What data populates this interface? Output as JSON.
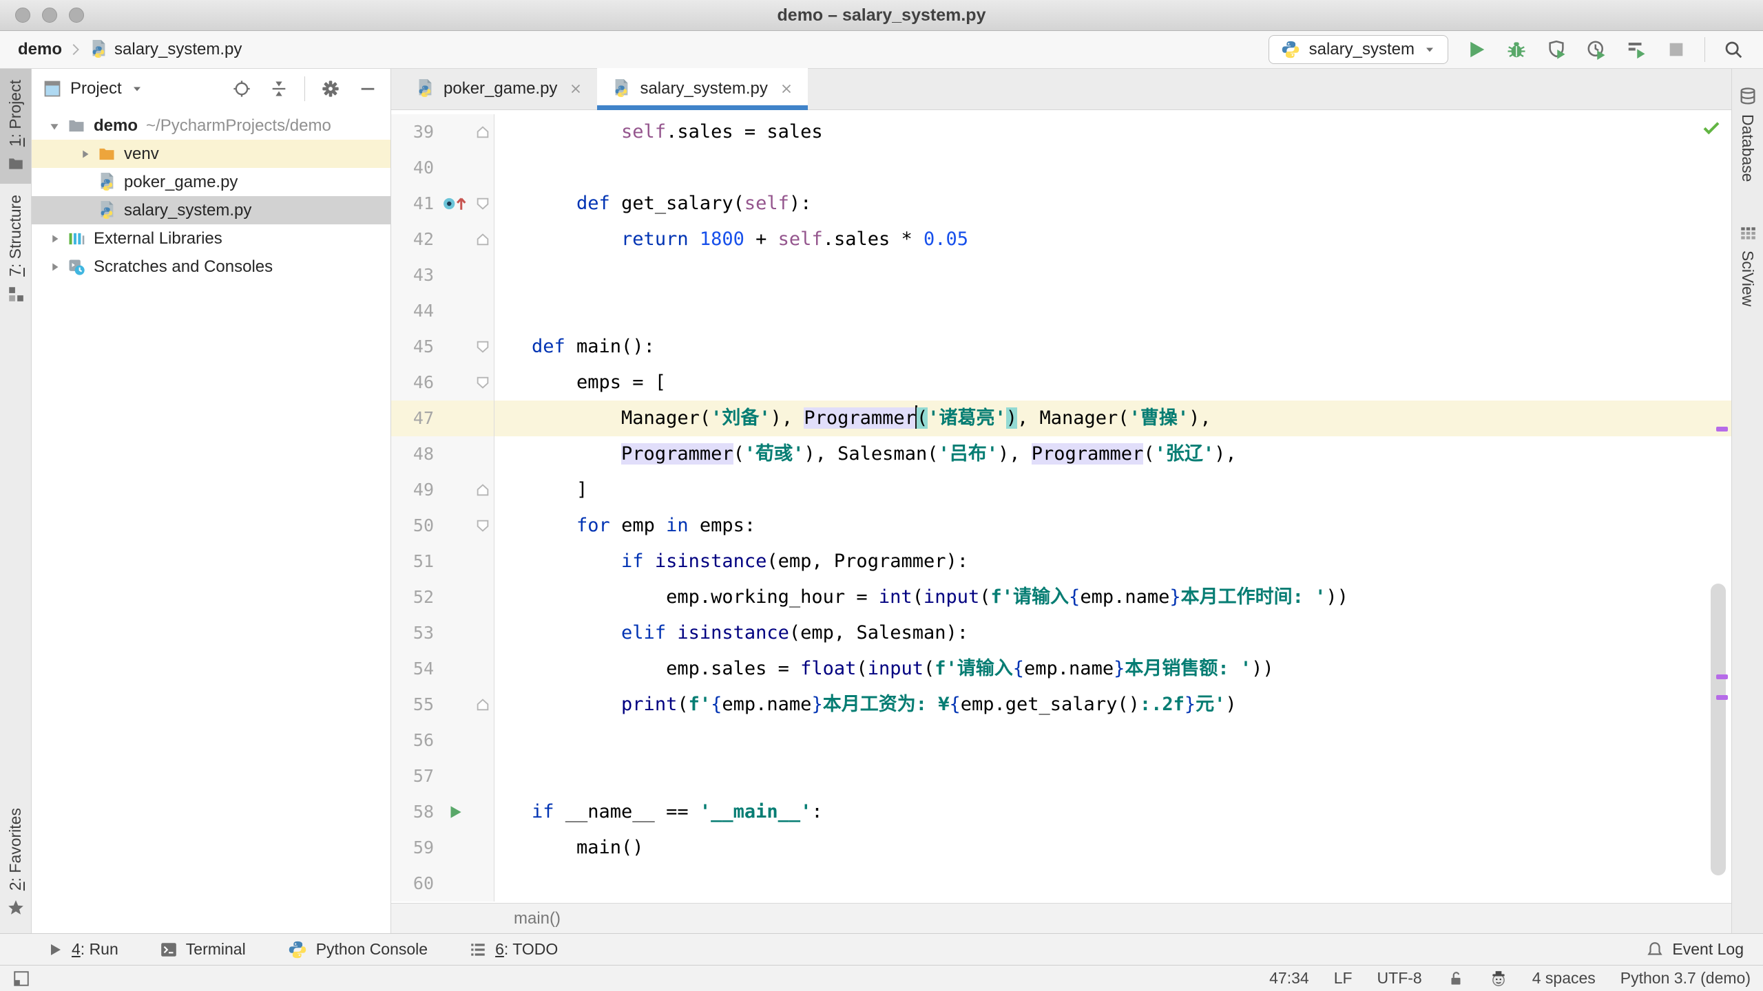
{
  "window": {
    "title": "demo – salary_system.py"
  },
  "navbar": {
    "breadcrumb_project": "demo",
    "breadcrumb_file": "salary_system.py",
    "run_config": "salary_system",
    "actions": [
      {
        "name": "run-button",
        "icon": "play"
      },
      {
        "name": "debug-button",
        "icon": "bug"
      },
      {
        "name": "run-with-coverage-button",
        "icon": "coverage"
      },
      {
        "name": "profiler-button",
        "icon": "profiler"
      },
      {
        "name": "concurrency-diagram-button",
        "icon": "concurrency"
      },
      {
        "name": "stop-button",
        "icon": "stop"
      },
      {
        "name": "divider"
      },
      {
        "name": "search-everywhere-button",
        "icon": "search"
      }
    ]
  },
  "left_stripe": {
    "top": [
      {
        "name": "project",
        "label": "1: Project",
        "mnemonic": "1",
        "icon": "folder-solid",
        "active": true
      },
      {
        "name": "structure",
        "label": "7: Structure",
        "mnemonic": "7",
        "icon": "structure",
        "active": false
      }
    ],
    "bottom": [
      {
        "name": "favorites",
        "label": "2: Favorites",
        "mnemonic": "2",
        "icon": "star",
        "active": false
      }
    ]
  },
  "right_stripe": {
    "items": [
      {
        "name": "database",
        "label": "Database",
        "icon": "database"
      },
      {
        "name": "sciview",
        "label": "SciView",
        "icon": "sciview"
      }
    ]
  },
  "project_panel": {
    "title": "Project",
    "actions": [
      {
        "name": "locate-file-button",
        "icon": "target"
      },
      {
        "name": "collapse-all-button",
        "icon": "collapse"
      },
      {
        "name": "divider"
      },
      {
        "name": "settings-button",
        "icon": "gear"
      },
      {
        "name": "hide-panel-button",
        "icon": "minus"
      }
    ],
    "tree": [
      {
        "name": "tree-item-demo",
        "level": 0,
        "arrow": "down",
        "icon": "folder",
        "label": "demo",
        "bold": true,
        "path": "~/PycharmProjects/demo"
      },
      {
        "name": "tree-item-venv",
        "level": 1,
        "arrow": "right",
        "icon": "folder-orange",
        "label": "venv",
        "highlight": true
      },
      {
        "name": "tree-item-poker-game",
        "level": 1,
        "arrow": null,
        "icon": "pyfile",
        "label": "poker_game.py"
      },
      {
        "name": "tree-item-salary-system",
        "level": 1,
        "arrow": null,
        "icon": "pyfile",
        "label": "salary_system.py",
        "selected": true
      },
      {
        "name": "tree-item-external-libraries",
        "level": 0,
        "arrow": "right",
        "icon": "extlibs",
        "label": "External Libraries"
      },
      {
        "name": "tree-item-scratches",
        "level": 0,
        "arrow": "right",
        "icon": "scratches",
        "label": "Scratches and Consoles"
      }
    ]
  },
  "editor": {
    "tabs": [
      {
        "name": "tab-poker-game",
        "label": "poker_game.py",
        "active": false
      },
      {
        "name": "tab-salary-system",
        "label": "salary_system.py",
        "active": true
      }
    ],
    "breadcrumb": "main()",
    "lines": [
      {
        "n": 39,
        "fold": "up",
        "tok": [
          [
            "t",
            "        "
          ],
          [
            "self",
            "self"
          ],
          [
            "t",
            ".sales = sales"
          ]
        ]
      },
      {
        "n": 40,
        "tok": []
      },
      {
        "n": 41,
        "icon": "override",
        "fold": "down",
        "tok": [
          [
            "t",
            "    "
          ],
          [
            "kw",
            "def"
          ],
          [
            "t",
            " get_salary("
          ],
          [
            "self",
            "self"
          ],
          [
            "t",
            "):"
          ]
        ]
      },
      {
        "n": 42,
        "fold": "up",
        "tok": [
          [
            "t",
            "        "
          ],
          [
            "kw",
            "return"
          ],
          [
            "t",
            " "
          ],
          [
            "num",
            "1800"
          ],
          [
            "t",
            " + "
          ],
          [
            "self",
            "self"
          ],
          [
            "t",
            ".sales * "
          ],
          [
            "num",
            "0.05"
          ]
        ]
      },
      {
        "n": 43,
        "tok": []
      },
      {
        "n": 44,
        "tok": []
      },
      {
        "n": 45,
        "fold": "down",
        "tok": [
          [
            "kw",
            "def"
          ],
          [
            "t",
            " main():"
          ]
        ]
      },
      {
        "n": 46,
        "fold": "down",
        "tok": [
          [
            "t",
            "    emps = ["
          ]
        ]
      },
      {
        "n": 47,
        "cur": true,
        "tok": [
          [
            "t",
            "        Manager("
          ],
          [
            "str",
            "'刘备'"
          ],
          [
            "t",
            "), "
          ],
          [
            "hlid",
            "Programmer"
          ],
          [
            "caret",
            ""
          ],
          [
            "hlparen",
            "("
          ],
          [
            "str",
            "'诸葛亮'"
          ],
          [
            "hlparen",
            ")"
          ],
          [
            "t",
            ", Manager("
          ],
          [
            "str",
            "'曹操'"
          ],
          [
            "t",
            "),"
          ]
        ]
      },
      {
        "n": 48,
        "tok": [
          [
            "t",
            "        "
          ],
          [
            "hlid",
            "Programmer"
          ],
          [
            "t",
            "("
          ],
          [
            "str",
            "'荀彧'"
          ],
          [
            "t",
            "), Salesman("
          ],
          [
            "str",
            "'吕布'"
          ],
          [
            "t",
            "), "
          ],
          [
            "hlid",
            "Programmer"
          ],
          [
            "t",
            "("
          ],
          [
            "str",
            "'张辽'"
          ],
          [
            "t",
            "),"
          ]
        ]
      },
      {
        "n": 49,
        "fold": "up",
        "tok": [
          [
            "t",
            "    ]"
          ]
        ]
      },
      {
        "n": 50,
        "fold": "down",
        "tok": [
          [
            "t",
            "    "
          ],
          [
            "kw",
            "for"
          ],
          [
            "t",
            " emp "
          ],
          [
            "kw",
            "in"
          ],
          [
            "t",
            " emps:"
          ]
        ]
      },
      {
        "n": 51,
        "tok": [
          [
            "t",
            "        "
          ],
          [
            "kw",
            "if"
          ],
          [
            "t",
            " "
          ],
          [
            "bi",
            "isinstance"
          ],
          [
            "t",
            "(emp, Programmer):"
          ]
        ]
      },
      {
        "n": 52,
        "tok": [
          [
            "t",
            "            emp.working_hour = "
          ],
          [
            "bi",
            "int"
          ],
          [
            "t",
            "("
          ],
          [
            "bi",
            "input"
          ],
          [
            "t",
            "("
          ],
          [
            "fstr",
            "f"
          ],
          [
            "str",
            "'请输入"
          ],
          [
            "brace",
            "{"
          ],
          [
            "t",
            "emp.name"
          ],
          [
            "brace",
            "}"
          ],
          [
            "str",
            "本月工作时间: '"
          ],
          [
            "t",
            "))"
          ]
        ]
      },
      {
        "n": 53,
        "tok": [
          [
            "t",
            "        "
          ],
          [
            "kw",
            "elif"
          ],
          [
            "t",
            " "
          ],
          [
            "bi",
            "isinstance"
          ],
          [
            "t",
            "(emp, Salesman):"
          ]
        ]
      },
      {
        "n": 54,
        "tok": [
          [
            "t",
            "            emp.sales = "
          ],
          [
            "bi",
            "float"
          ],
          [
            "t",
            "("
          ],
          [
            "bi",
            "input"
          ],
          [
            "t",
            "("
          ],
          [
            "fstr",
            "f"
          ],
          [
            "str",
            "'请输入"
          ],
          [
            "brace",
            "{"
          ],
          [
            "t",
            "emp.name"
          ],
          [
            "brace",
            "}"
          ],
          [
            "str",
            "本月销售额: '"
          ],
          [
            "t",
            "))"
          ]
        ]
      },
      {
        "n": 55,
        "fold": "up",
        "tok": [
          [
            "t",
            "        "
          ],
          [
            "bi",
            "print"
          ],
          [
            "t",
            "("
          ],
          [
            "fstr",
            "f"
          ],
          [
            "str",
            "'"
          ],
          [
            "brace",
            "{"
          ],
          [
            "t",
            "emp.name"
          ],
          [
            "brace",
            "}"
          ],
          [
            "str",
            "本月工资为: ¥"
          ],
          [
            "brace",
            "{"
          ],
          [
            "t",
            "emp.get_salary()"
          ],
          [
            "fmt",
            ":.2f"
          ],
          [
            "brace",
            "}"
          ],
          [
            "str",
            "元'"
          ],
          [
            "t",
            ")"
          ]
        ]
      },
      {
        "n": 56,
        "tok": []
      },
      {
        "n": 57,
        "tok": []
      },
      {
        "n": 58,
        "icon": "run",
        "tok": [
          [
            "kw",
            "if"
          ],
          [
            "t",
            " __name__ == "
          ],
          [
            "str",
            "'"
          ],
          [
            "fmt",
            "__main__"
          ],
          [
            "str",
            "'"
          ],
          [
            "t",
            ":"
          ]
        ]
      },
      {
        "n": 59,
        "tok": [
          [
            "t",
            "    main()"
          ]
        ]
      },
      {
        "n": 60,
        "tok": []
      }
    ]
  },
  "toolrow": {
    "left": [
      {
        "name": "tool-window-run",
        "label": "4: Run",
        "mnemonic": "4",
        "icon": "run-small"
      },
      {
        "name": "tool-window-terminal",
        "label": "Terminal",
        "icon": "terminal"
      },
      {
        "name": "tool-window-python-console",
        "label": "Python Console",
        "icon": "python"
      },
      {
        "name": "tool-window-todo",
        "label": "6: TODO",
        "mnemonic": "6",
        "icon": "todo"
      }
    ],
    "right": [
      {
        "name": "event-log",
        "label": "Event Log",
        "icon": "bell"
      }
    ]
  },
  "statusbar": {
    "items": [
      {
        "type": "text",
        "name": "caret-position",
        "text": "47:34"
      },
      {
        "type": "text",
        "name": "line-separator",
        "text": "LF"
      },
      {
        "type": "text",
        "name": "file-encoding",
        "text": "UTF-8"
      },
      {
        "type": "icon",
        "name": "readonly-toggle",
        "icon": "unlock"
      },
      {
        "type": "icon",
        "name": "inspections-profile",
        "icon": "hector"
      },
      {
        "type": "text",
        "name": "indent-size",
        "text": "4 spaces"
      },
      {
        "type": "text",
        "name": "interpreter",
        "text": "Python 3.7 (demo)"
      }
    ]
  },
  "colors": {
    "tab_accent": "#4083c9",
    "run_green": "#59a869",
    "keyword_blue": "#0033b3",
    "builtin_navy": "#000080",
    "number_blue": "#1750eb",
    "self_purple": "#94558d",
    "string_teal": "#067d73",
    "caret_row": "#faf5dc",
    "usage_lavender": "#e1defa",
    "paren_match": "#93dad3",
    "error_stripe_purple": "#b66be8"
  }
}
